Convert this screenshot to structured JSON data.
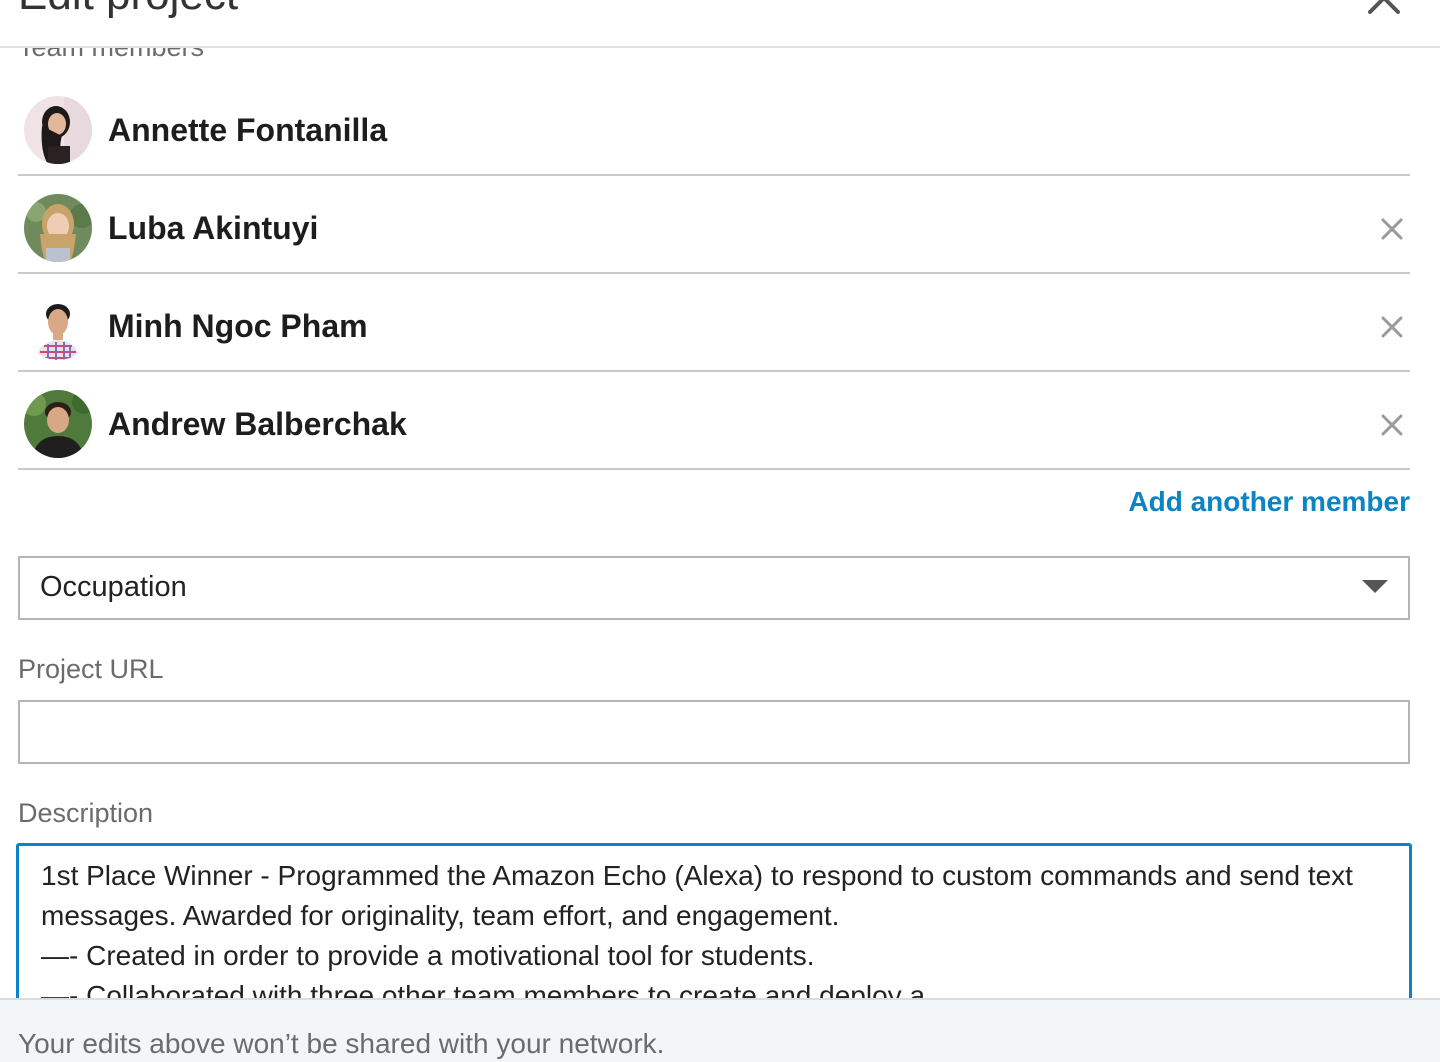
{
  "header": {
    "title": "Edit project"
  },
  "team": {
    "label": "Team members",
    "members": [
      {
        "name": "Annette Fontanilla",
        "removable": false
      },
      {
        "name": "Luba Akintuyi",
        "removable": true
      },
      {
        "name": "Minh Ngoc Pham",
        "removable": true
      },
      {
        "name": "Andrew Balberchak",
        "removable": true
      }
    ],
    "add_label": "Add another member"
  },
  "occupation": {
    "value": "Occupation"
  },
  "project_url": {
    "label": "Project URL",
    "value": ""
  },
  "description": {
    "label": "Description",
    "lines": [
      "1st Place Winner - Programmed the Amazon Echo (Alexa) to respond to custom commands and send text",
      "messages. Awarded for originality, team effort, and engagement.",
      "—- Created in order to provide a motivational tool for students.",
      "—- Collaborated with three other team members to create and deploy a"
    ]
  },
  "footer": {
    "note": "Your edits above won’t be shared with your network."
  },
  "colors": {
    "accent": "#0a84c2",
    "label_gray": "#6b6b6b",
    "border": "#b5b5b5",
    "footer_bg": "#f3f6f8"
  },
  "icons": {
    "close": "close-icon",
    "remove": "remove-member-icon",
    "caret": "caret-down-icon"
  }
}
